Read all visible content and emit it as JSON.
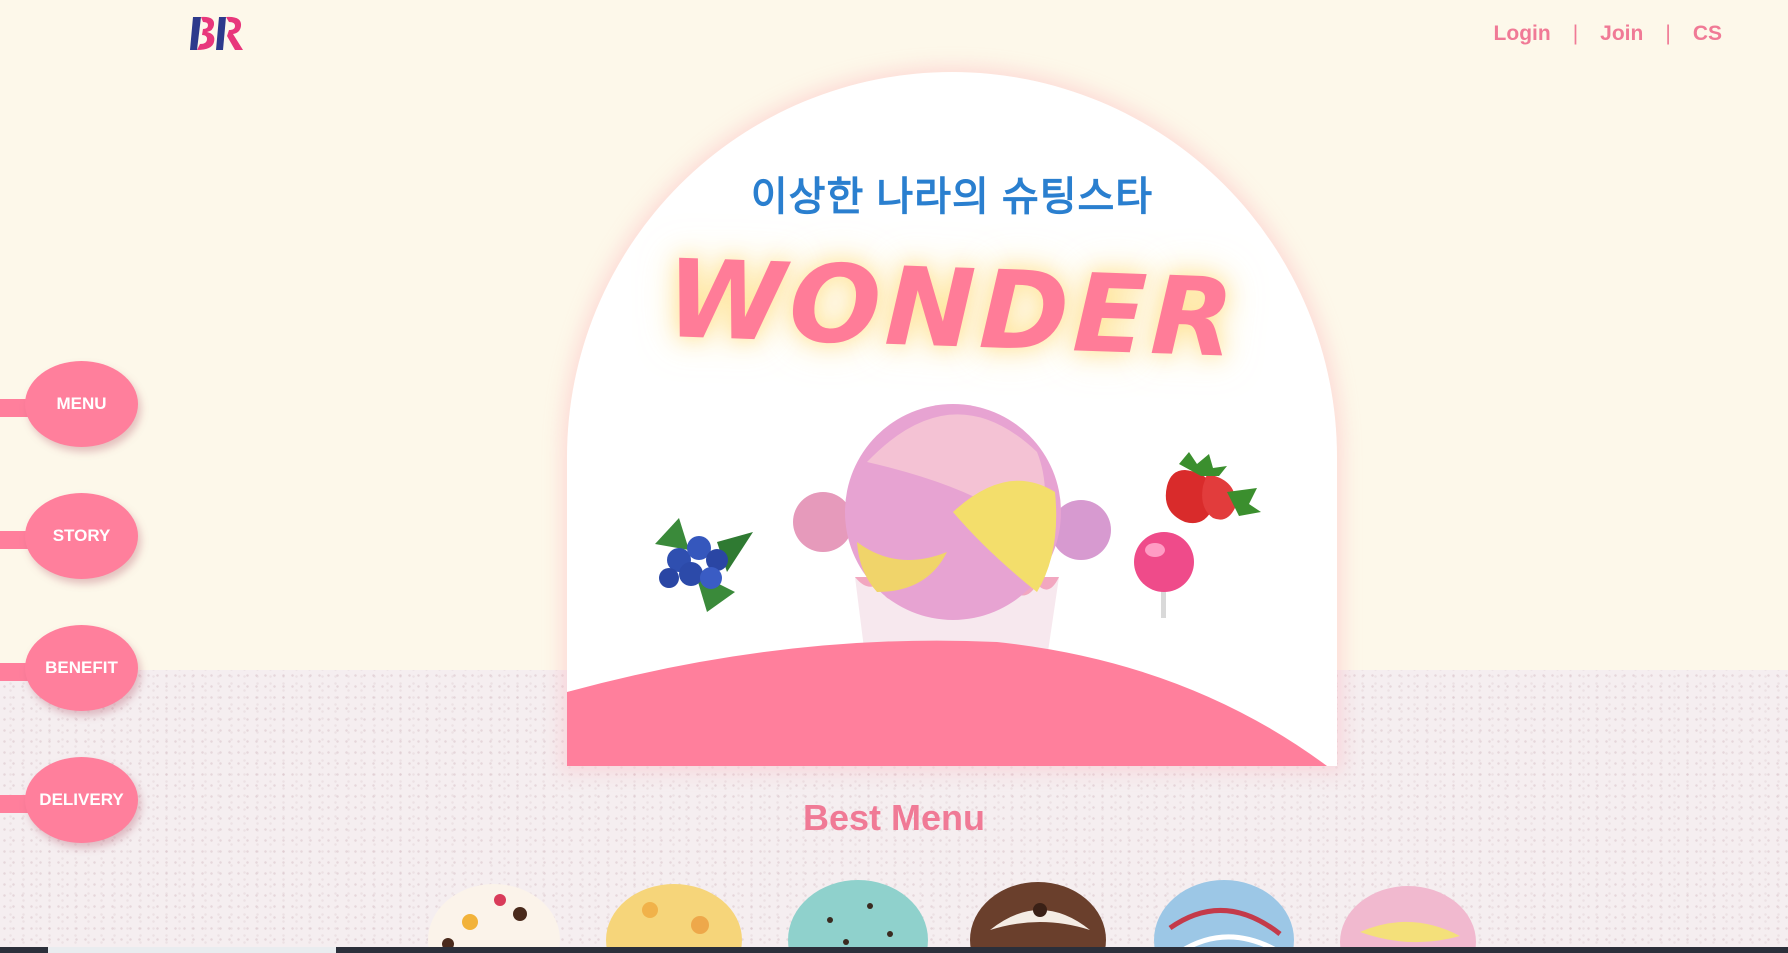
{
  "brand": {
    "logo_text": "BR",
    "colors": {
      "pink": "#ff7f9c",
      "blue_letter": "#2d3a8c",
      "accent_text": "#f07a96",
      "hero_sub": "#2a7fcf"
    }
  },
  "top_nav": {
    "login": "Login",
    "join": "Join",
    "cs": "CS",
    "separator": "|"
  },
  "side_nav": {
    "items": [
      {
        "label": "MENU"
      },
      {
        "label": "STORY"
      },
      {
        "label": "BENEFIT"
      },
      {
        "label": "DELIVERY"
      }
    ]
  },
  "hero": {
    "subtitle": "이상한 나라의 슈팅스타",
    "title": "WONDER",
    "images": [
      "ice-cream-cup-icon",
      "blueberry-icon",
      "strawberry-icon",
      "lollipop-icon"
    ]
  },
  "best_menu": {
    "title": "Best Menu",
    "scoop_icons": [
      "scoop-icon",
      "scoop-icon",
      "scoop-icon",
      "scoop-icon",
      "scoop-icon",
      "scoop-icon"
    ]
  }
}
